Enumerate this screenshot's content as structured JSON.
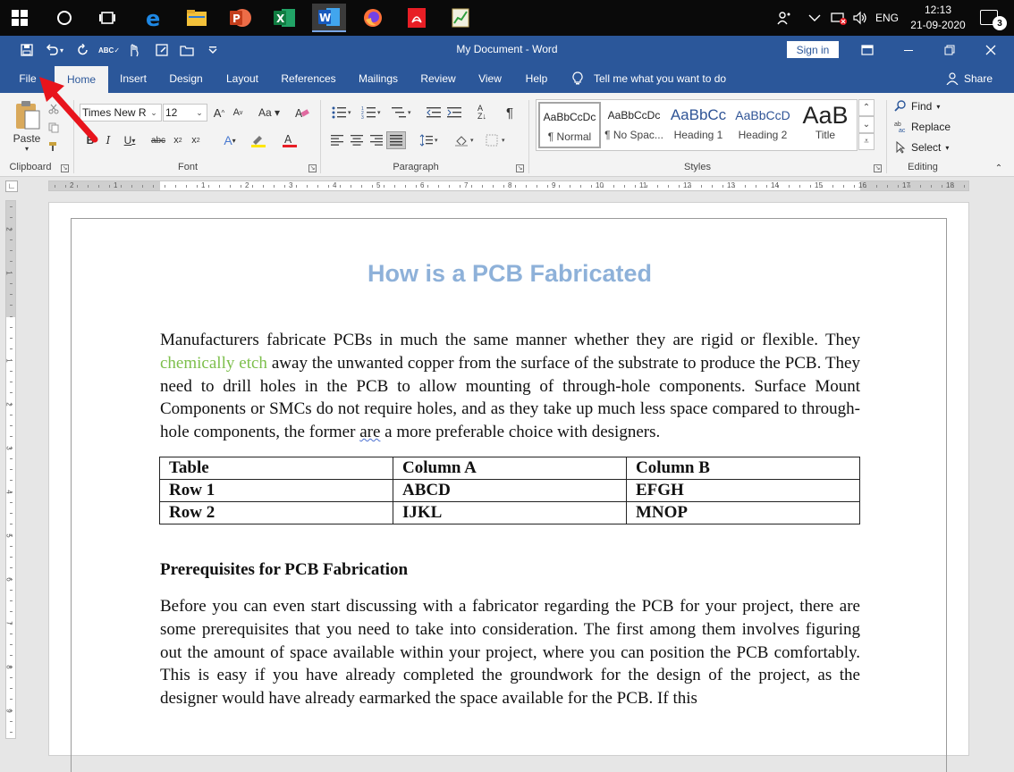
{
  "taskbar": {
    "tray": {
      "language": "ENG",
      "time": "12:13",
      "date": "21-09-2020",
      "notification_count": "3"
    }
  },
  "titlebar": {
    "document_title": "My Document  -  Word",
    "sign_in_label": "Sign in"
  },
  "tabs": [
    "File",
    "Home",
    "Insert",
    "Design",
    "Layout",
    "References",
    "Mailings",
    "Review",
    "View",
    "Help"
  ],
  "tell_me": "Tell me what you want to do",
  "share_label": "Share",
  "ribbon": {
    "clipboard": {
      "paste_label": "Paste",
      "group_label": "Clipboard"
    },
    "font": {
      "font_name": "Times New R",
      "font_size": "12",
      "group_label": "Font"
    },
    "paragraph": {
      "group_label": "Paragraph"
    },
    "styles": {
      "group_label": "Styles",
      "items": [
        {
          "preview": "AaBbCcDc",
          "name": "¶ Normal"
        },
        {
          "preview": "AaBbCcDc",
          "name": "¶ No Spac..."
        },
        {
          "preview": "AaBbCc",
          "name": "Heading 1"
        },
        {
          "preview": "AaBbCcD",
          "name": "Heading 2"
        },
        {
          "preview": "AaB",
          "name": "Title"
        }
      ]
    },
    "editing": {
      "find_label": "Find",
      "replace_label": "Replace",
      "select_label": "Select",
      "group_label": "Editing"
    }
  },
  "ruler": {
    "h_numbers": [
      "2",
      "1",
      "1",
      "2",
      "3",
      "4",
      "5",
      "6",
      "7",
      "8",
      "9",
      "10",
      "11",
      "12",
      "13",
      "14",
      "15",
      "16",
      "17",
      "18"
    ],
    "v_numbers": [
      "2",
      "1",
      "1",
      "2",
      "3",
      "4",
      "5",
      "6",
      "7",
      "8",
      "9"
    ]
  },
  "document": {
    "heading": "How is a PCB Fabricated",
    "para1": {
      "before": "Manufacturers fabricate PCBs in much the same manner whether they are rigid or flexible. They ",
      "link": "chemically etch",
      "middle": " away the unwanted copper from the surface of the substrate to produce the PCB. They need to drill holes in the PCB to allow mounting of through-hole components. Surface Mount Components or SMCs do not require holes, and as they take up much less space compared to through-hole components, the former ",
      "flagged": "are",
      "after": " a more preferable choice with designers."
    },
    "table": {
      "rows": [
        [
          "Table",
          "Column A",
          "Column B"
        ],
        [
          "Row 1",
          "ABCD",
          "EFGH"
        ],
        [
          "Row 2",
          "IJKL",
          "MNOP"
        ]
      ]
    },
    "subheading": "Prerequisites for PCB Fabrication",
    "para2": "Before you can even start discussing with a fabricator regarding the PCB for your project, there are some prerequisites that you need to take into consideration. The first among them involves figuring out the amount of space available within your project, where you can position the PCB comfortably. This is easy if you have already completed the groundwork for the design of the project, as the designer would have already earmarked the space available for the PCB. If this"
  },
  "colors": {
    "word_blue": "#2b579a",
    "heading_blue": "#8eb1d9",
    "link_green": "#7dbf4c",
    "annotation_red": "#e8141c"
  }
}
